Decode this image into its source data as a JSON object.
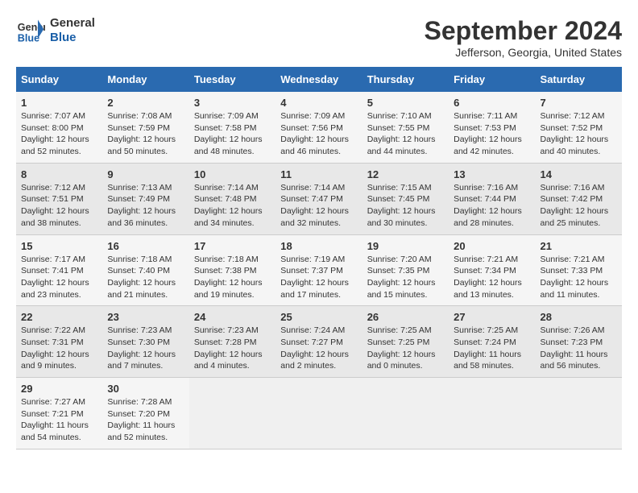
{
  "logo": {
    "text_general": "General",
    "text_blue": "Blue"
  },
  "header": {
    "title": "September 2024",
    "subtitle": "Jefferson, Georgia, United States"
  },
  "days_of_week": [
    "Sunday",
    "Monday",
    "Tuesday",
    "Wednesday",
    "Thursday",
    "Friday",
    "Saturday"
  ],
  "weeks": [
    [
      {
        "day": "1",
        "sunrise": "7:07 AM",
        "sunset": "8:00 PM",
        "daylight": "12 hours and 52 minutes."
      },
      {
        "day": "2",
        "sunrise": "7:08 AM",
        "sunset": "7:59 PM",
        "daylight": "12 hours and 50 minutes."
      },
      {
        "day": "3",
        "sunrise": "7:09 AM",
        "sunset": "7:58 PM",
        "daylight": "12 hours and 48 minutes."
      },
      {
        "day": "4",
        "sunrise": "7:09 AM",
        "sunset": "7:56 PM",
        "daylight": "12 hours and 46 minutes."
      },
      {
        "day": "5",
        "sunrise": "7:10 AM",
        "sunset": "7:55 PM",
        "daylight": "12 hours and 44 minutes."
      },
      {
        "day": "6",
        "sunrise": "7:11 AM",
        "sunset": "7:53 PM",
        "daylight": "12 hours and 42 minutes."
      },
      {
        "day": "7",
        "sunrise": "7:12 AM",
        "sunset": "7:52 PM",
        "daylight": "12 hours and 40 minutes."
      }
    ],
    [
      {
        "day": "8",
        "sunrise": "7:12 AM",
        "sunset": "7:51 PM",
        "daylight": "12 hours and 38 minutes."
      },
      {
        "day": "9",
        "sunrise": "7:13 AM",
        "sunset": "7:49 PM",
        "daylight": "12 hours and 36 minutes."
      },
      {
        "day": "10",
        "sunrise": "7:14 AM",
        "sunset": "7:48 PM",
        "daylight": "12 hours and 34 minutes."
      },
      {
        "day": "11",
        "sunrise": "7:14 AM",
        "sunset": "7:47 PM",
        "daylight": "12 hours and 32 minutes."
      },
      {
        "day": "12",
        "sunrise": "7:15 AM",
        "sunset": "7:45 PM",
        "daylight": "12 hours and 30 minutes."
      },
      {
        "day": "13",
        "sunrise": "7:16 AM",
        "sunset": "7:44 PM",
        "daylight": "12 hours and 28 minutes."
      },
      {
        "day": "14",
        "sunrise": "7:16 AM",
        "sunset": "7:42 PM",
        "daylight": "12 hours and 25 minutes."
      }
    ],
    [
      {
        "day": "15",
        "sunrise": "7:17 AM",
        "sunset": "7:41 PM",
        "daylight": "12 hours and 23 minutes."
      },
      {
        "day": "16",
        "sunrise": "7:18 AM",
        "sunset": "7:40 PM",
        "daylight": "12 hours and 21 minutes."
      },
      {
        "day": "17",
        "sunrise": "7:18 AM",
        "sunset": "7:38 PM",
        "daylight": "12 hours and 19 minutes."
      },
      {
        "day": "18",
        "sunrise": "7:19 AM",
        "sunset": "7:37 PM",
        "daylight": "12 hours and 17 minutes."
      },
      {
        "day": "19",
        "sunrise": "7:20 AM",
        "sunset": "7:35 PM",
        "daylight": "12 hours and 15 minutes."
      },
      {
        "day": "20",
        "sunrise": "7:21 AM",
        "sunset": "7:34 PM",
        "daylight": "12 hours and 13 minutes."
      },
      {
        "day": "21",
        "sunrise": "7:21 AM",
        "sunset": "7:33 PM",
        "daylight": "12 hours and 11 minutes."
      }
    ],
    [
      {
        "day": "22",
        "sunrise": "7:22 AM",
        "sunset": "7:31 PM",
        "daylight": "12 hours and 9 minutes."
      },
      {
        "day": "23",
        "sunrise": "7:23 AM",
        "sunset": "7:30 PM",
        "daylight": "12 hours and 7 minutes."
      },
      {
        "day": "24",
        "sunrise": "7:23 AM",
        "sunset": "7:28 PM",
        "daylight": "12 hours and 4 minutes."
      },
      {
        "day": "25",
        "sunrise": "7:24 AM",
        "sunset": "7:27 PM",
        "daylight": "12 hours and 2 minutes."
      },
      {
        "day": "26",
        "sunrise": "7:25 AM",
        "sunset": "7:25 PM",
        "daylight": "12 hours and 0 minutes."
      },
      {
        "day": "27",
        "sunrise": "7:25 AM",
        "sunset": "7:24 PM",
        "daylight": "11 hours and 58 minutes."
      },
      {
        "day": "28",
        "sunrise": "7:26 AM",
        "sunset": "7:23 PM",
        "daylight": "11 hours and 56 minutes."
      }
    ],
    [
      {
        "day": "29",
        "sunrise": "7:27 AM",
        "sunset": "7:21 PM",
        "daylight": "11 hours and 54 minutes."
      },
      {
        "day": "30",
        "sunrise": "7:28 AM",
        "sunset": "7:20 PM",
        "daylight": "11 hours and 52 minutes."
      },
      null,
      null,
      null,
      null,
      null
    ]
  ]
}
